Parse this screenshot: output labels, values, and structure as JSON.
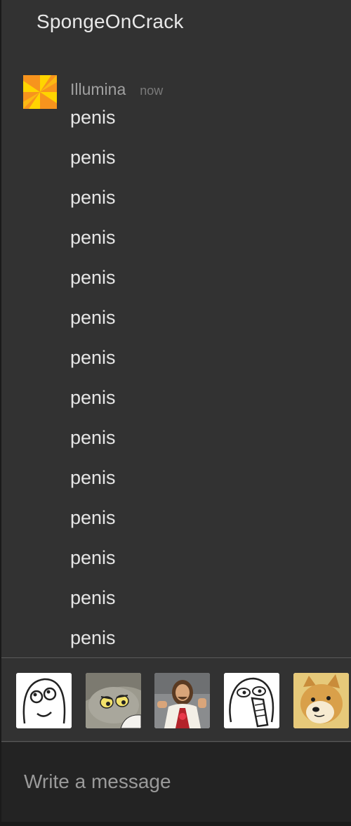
{
  "chat": {
    "title": "SpongeOnCrack"
  },
  "message_group": {
    "avatar_icon": "pinwheel-avatar-icon",
    "sender": "Illumina",
    "timestamp": "now",
    "messages": [
      "penis",
      "penis",
      "penis",
      "penis",
      "penis",
      "penis",
      "penis",
      "penis",
      "penis",
      "penis",
      "penis",
      "penis",
      "penis",
      "penis"
    ]
  },
  "stickers": [
    {
      "name": "derp-face-sticker-icon"
    },
    {
      "name": "unsettled-tom-sticker-icon"
    },
    {
      "name": "buddy-christ-sticker-icon"
    },
    {
      "name": "lol-face-sticker-icon"
    },
    {
      "name": "doge-sticker-icon"
    }
  ],
  "composer": {
    "placeholder": "Write a message"
  },
  "colors": {
    "background": "#323232",
    "composer_background": "#232323",
    "avatar_orange": "#f7941d",
    "avatar_yellow": "#ffd400"
  }
}
